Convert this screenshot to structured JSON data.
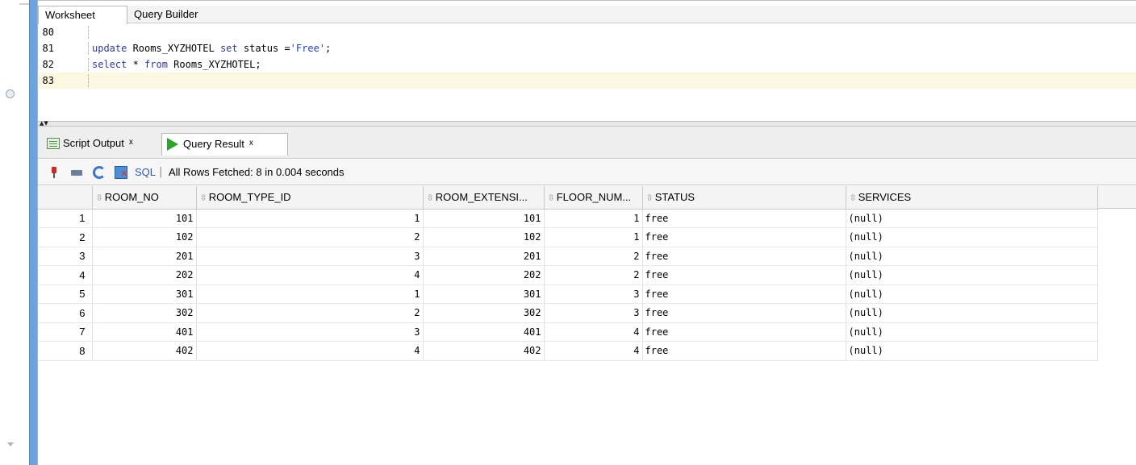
{
  "editor": {
    "tabs": [
      {
        "label": "Worksheet",
        "active": true
      },
      {
        "label": "Query Builder",
        "active": false
      }
    ],
    "lines": [
      {
        "num": "80",
        "code": ""
      },
      {
        "num": "81",
        "code": "update Rooms_XYZHOTEL set status ='Free';"
      },
      {
        "num": "82",
        "code": "select * from Rooms_XYZHOTEL;"
      },
      {
        "num": "83",
        "code": ""
      }
    ]
  },
  "results": {
    "tabs": [
      {
        "label": "Script Output",
        "icon": "script-output-icon"
      },
      {
        "label": "Query Result",
        "icon": "play-icon",
        "active": true
      }
    ],
    "close_glyph": "x",
    "toolbar": {
      "sql_label": "SQL",
      "separator": "|",
      "status": "All Rows Fetched: 8 in 0.004 seconds"
    },
    "columns": [
      "ROOM_NO",
      "ROOM_TYPE_ID",
      "ROOM_EXTENSI...",
      "FLOOR_NUM...",
      "STATUS",
      "SERVICES"
    ],
    "rows": [
      [
        "1",
        "101",
        "1",
        "101",
        "1",
        "free",
        "(null)"
      ],
      [
        "2",
        "102",
        "2",
        "102",
        "1",
        "free",
        "(null)"
      ],
      [
        "3",
        "201",
        "3",
        "201",
        "2",
        "free",
        "(null)"
      ],
      [
        "4",
        "202",
        "4",
        "202",
        "2",
        "free",
        "(null)"
      ],
      [
        "5",
        "301",
        "1",
        "301",
        "3",
        "free",
        "(null)"
      ],
      [
        "6",
        "302",
        "2",
        "302",
        "3",
        "free",
        "(null)"
      ],
      [
        "7",
        "401",
        "3",
        "401",
        "4",
        "free",
        "(null)"
      ],
      [
        "8",
        "402",
        "4",
        "402",
        "4",
        "free",
        "(null)"
      ]
    ]
  },
  "colors": {
    "accent_bar": "#6fa3dc",
    "keyword": "#2b3aa8",
    "current_line": "#fbf7e1"
  }
}
